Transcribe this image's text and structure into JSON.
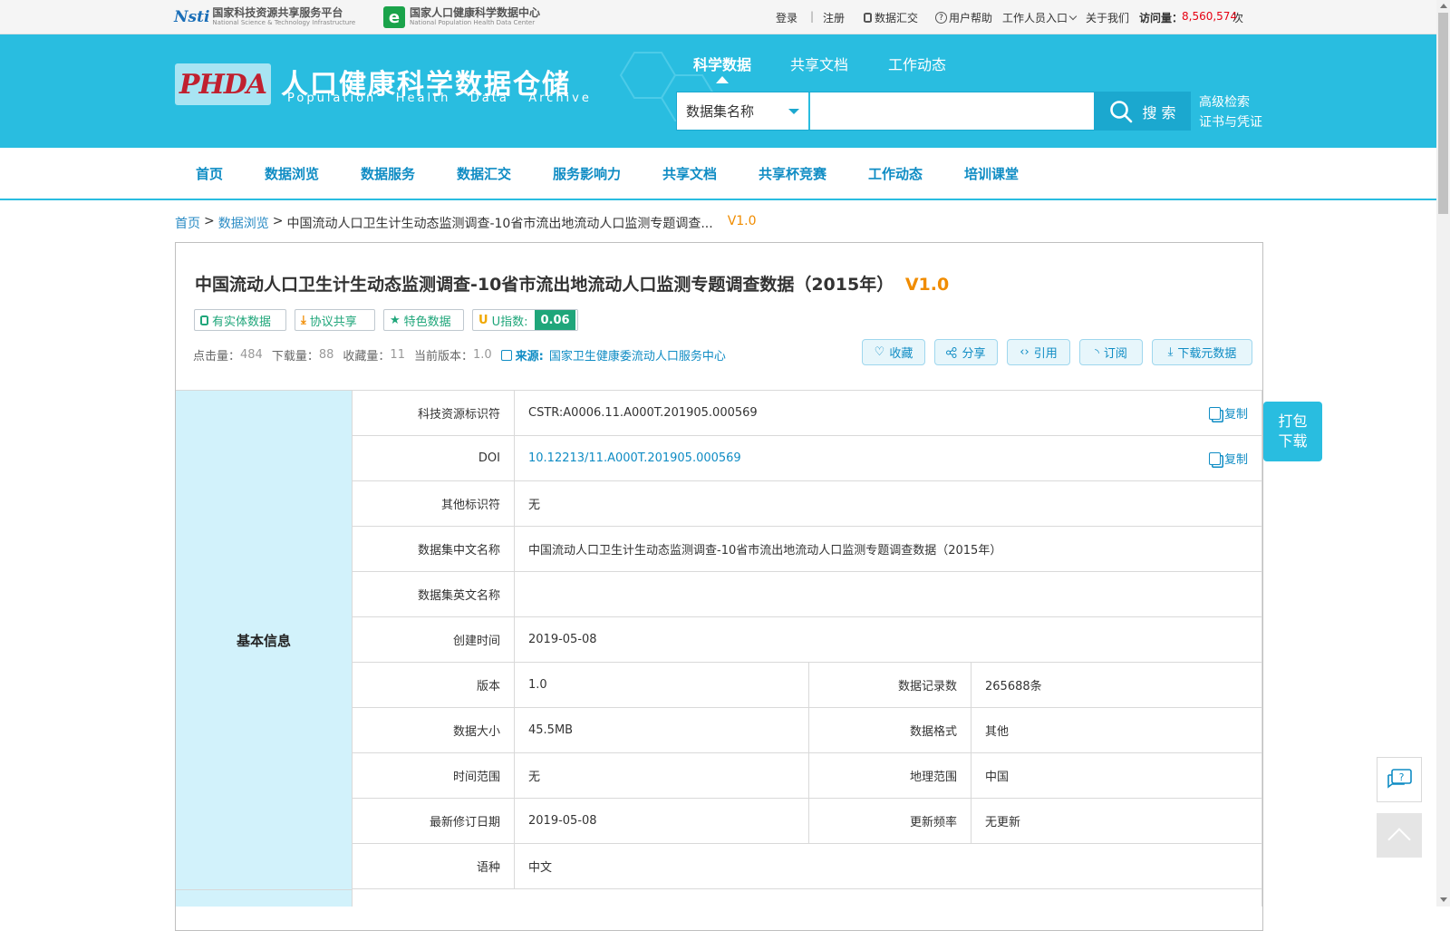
{
  "topbar": {
    "logo1_cn": "国家科技资源共享服务平台",
    "logo1_en": "National Science & Technology Infrastructure",
    "logo1_mark": "Nsti",
    "logo2_cn": "国家人口健康科学数据中心",
    "logo2_en": "National Population Health Data Center",
    "logo2_mark": "e",
    "login": "登录",
    "sep": "|",
    "register": "注册",
    "data_exchange": "数据汇交",
    "help": "用户帮助",
    "staff": "工作人员入口",
    "about": "关于我们",
    "visits_label": "访问量：",
    "visits_value": "8,560,574",
    "visits_unit": "次"
  },
  "header": {
    "logo_mark": "PHDA",
    "title_cn": "人口健康科学数据仓储",
    "title_en": "Population   Health   Data   Archive",
    "tabs": [
      "科学数据",
      "共享文档",
      "工作动态"
    ],
    "search_select": "数据集名称",
    "search_placeholder": "",
    "search_button": "搜 索",
    "advanced": "高级检索",
    "certificate": "证书与凭证"
  },
  "nav": [
    "首页",
    "数据浏览",
    "数据服务",
    "数据汇交",
    "服务影响力",
    "共享文档",
    "共享杯竞赛",
    "工作动态",
    "培训课堂"
  ],
  "breadcrumb": {
    "home": "首页",
    "sep": ">",
    "browse": "数据浏览",
    "current": "中国流动人口卫生计生动态监测调查-10省市流出地流动人口监测专题调查...",
    "version": "V1.0"
  },
  "dataset": {
    "title": "中国流动人口卫生计生动态监测调查-10省市流出地流动人口监测专题调查数据（2015年）",
    "version": "V1.0",
    "tags": [
      "有实体数据",
      "协议共享",
      "特色数据"
    ],
    "u_index_label": "U指数:",
    "u_index_value": "0.06",
    "clicks_label": "点击量：",
    "clicks": "484",
    "downloads_label": "下载量：",
    "downloads": "88",
    "favorites_label": "收藏量：",
    "favorites": "11",
    "current_version_label": "当前版本：",
    "current_version": "1.0",
    "source_label": "来源:",
    "source": "国家卫生健康委流动人口服务中心",
    "actions": [
      "收藏",
      "分享",
      "引用",
      "订阅",
      "下载元数据"
    ]
  },
  "basic_info": {
    "section": "基本信息",
    "copy": "复制",
    "rows": [
      {
        "label": "科技资源标识符",
        "value": "CSTR:A0006.11.A000T.201905.000569"
      },
      {
        "label": "DOI",
        "value": "10.12213/11.A000T.201905.000569"
      },
      {
        "label": "其他标识符",
        "value": "无"
      },
      {
        "label": "数据集中文名称",
        "value": "中国流动人口卫生计生动态监测调查-10省市流出地流动人口监测专题调查数据（2015年）"
      },
      {
        "label": "数据集英文名称",
        "value": ""
      },
      {
        "label": "创建时间",
        "value": "2019-05-08"
      },
      {
        "label": "版本",
        "value": "1.0",
        "label2": "数据记录数",
        "value2": "265688条"
      },
      {
        "label": "数据大小",
        "value": "45.5MB",
        "label2": "数据格式",
        "value2": "其他"
      },
      {
        "label": "时间范围",
        "value": "无",
        "label2": "地理范围",
        "value2": "中国"
      },
      {
        "label": "最新修订日期",
        "value": "2019-05-08",
        "label2": "更新频率",
        "value2": "无更新"
      },
      {
        "label": "语种",
        "value": "中文"
      }
    ]
  },
  "float": {
    "pack_download": [
      "打包",
      "下载"
    ]
  },
  "colors": {
    "primary": "#29bde0",
    "nav_text": "#0f8cc4",
    "version": "#f08c00",
    "tag_green": "#1fa67a",
    "section_bg": "#d2f2fb"
  }
}
